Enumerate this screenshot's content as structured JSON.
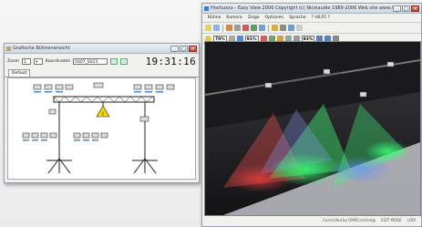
{
  "left_window": {
    "title": "Grafische Bühnenansicht",
    "zoom_label": "Zoom",
    "zoom_value": "1",
    "coord_label": "Koordinaten",
    "coord_value": "0407_0023",
    "clock": "19:31:16",
    "tab_label": "Default"
  },
  "right_window": {
    "title": "Hoxhuxxx - Easy View 2006    Copyright (c) Nicolaudie 1989-2006    Web site www.nicolaudie.c...",
    "menu": [
      "Bühne",
      "Kamera",
      "Zeige",
      "Optionen",
      "Sprache",
      "? HILFE ?"
    ],
    "zoom1": "70%",
    "zoom2": "91%",
    "zoom3": "93%",
    "status_left": "Controlled by OMRCcontrol@",
    "status_mid": "EDIT MODE",
    "status_right": "LOW"
  }
}
